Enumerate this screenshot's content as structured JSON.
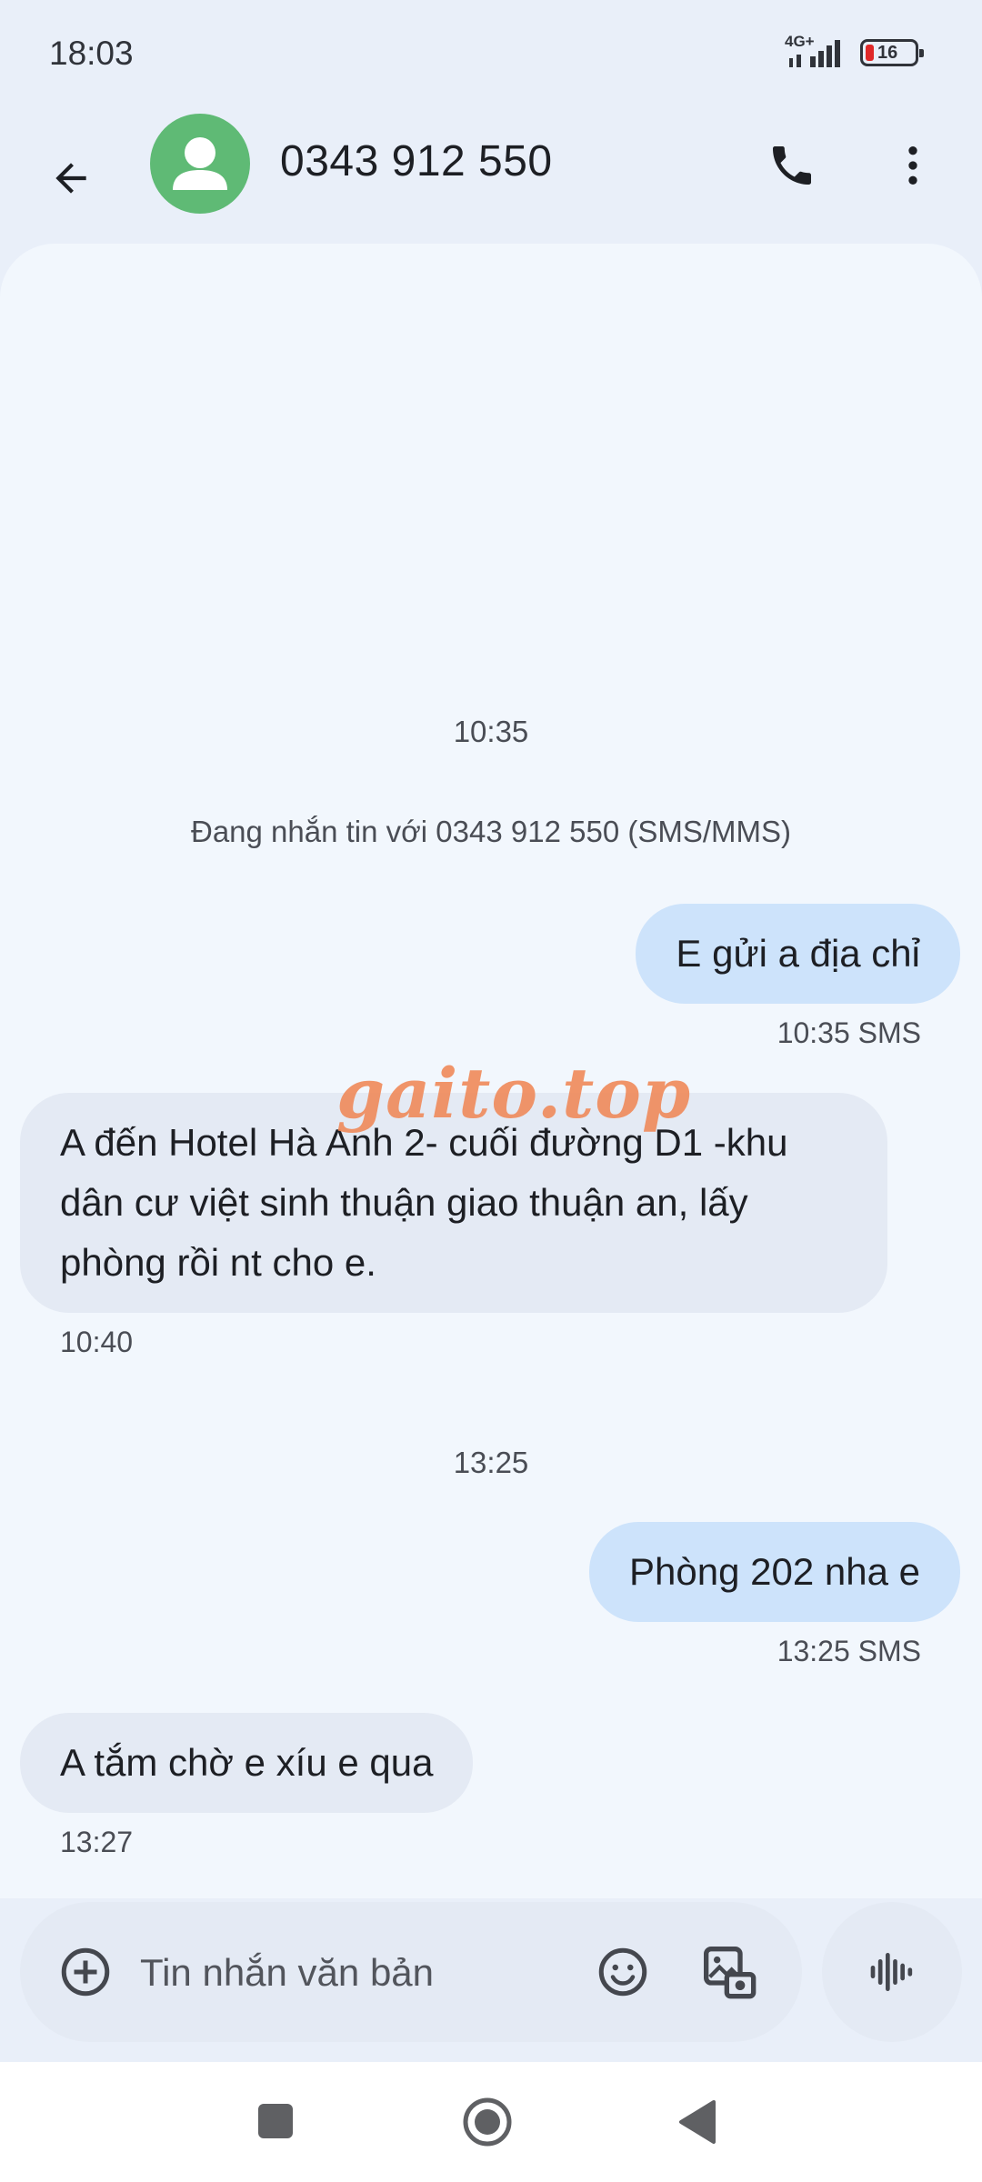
{
  "status_bar": {
    "time": "18:03",
    "network": "4G+",
    "battery": "16",
    "battery_color": "#e02828"
  },
  "header": {
    "title": "0343 912 550",
    "back_icon": "arrow-left-icon",
    "avatar_icon": "person-icon",
    "avatar_color": "#5fba75",
    "call_icon": "phone-icon",
    "menu_icon": "more-vert-icon"
  },
  "conversation": {
    "divider_1": "10:35",
    "info": "Đang nhắn tin với 0343 912 550 (SMS/MMS)",
    "messages": [
      {
        "direction": "out",
        "text": "E gửi a địa chỉ",
        "meta": "10:35  SMS"
      },
      {
        "direction": "in",
        "text": "A đến Hotel Hà Anh 2- cuối đường D1 -khu dân cư việt sinh thuận giao thuận an, lấy phòng rồi nt cho e.",
        "meta": "10:40"
      },
      {
        "direction": "out",
        "text": "Phòng 202 nha e",
        "meta": "13:25  SMS"
      },
      {
        "direction": "in",
        "text": "A tắm chờ e xíu e qua",
        "meta": "13:27"
      }
    ],
    "divider_2": "13:25",
    "outgoing_color": "#cde3fb",
    "incoming_color": "#e4eaf4"
  },
  "watermark": "gaito.top",
  "composer": {
    "placeholder": "Tin nhắn văn bản",
    "add_icon": "add-circle-icon",
    "emoji_icon": "emoji-icon",
    "media_icon": "gallery-icon",
    "voice_icon": "voice-wave-icon"
  },
  "nav": {
    "recent_icon": "square-icon",
    "home_icon": "circle-icon",
    "back_icon": "triangle-back-icon"
  }
}
